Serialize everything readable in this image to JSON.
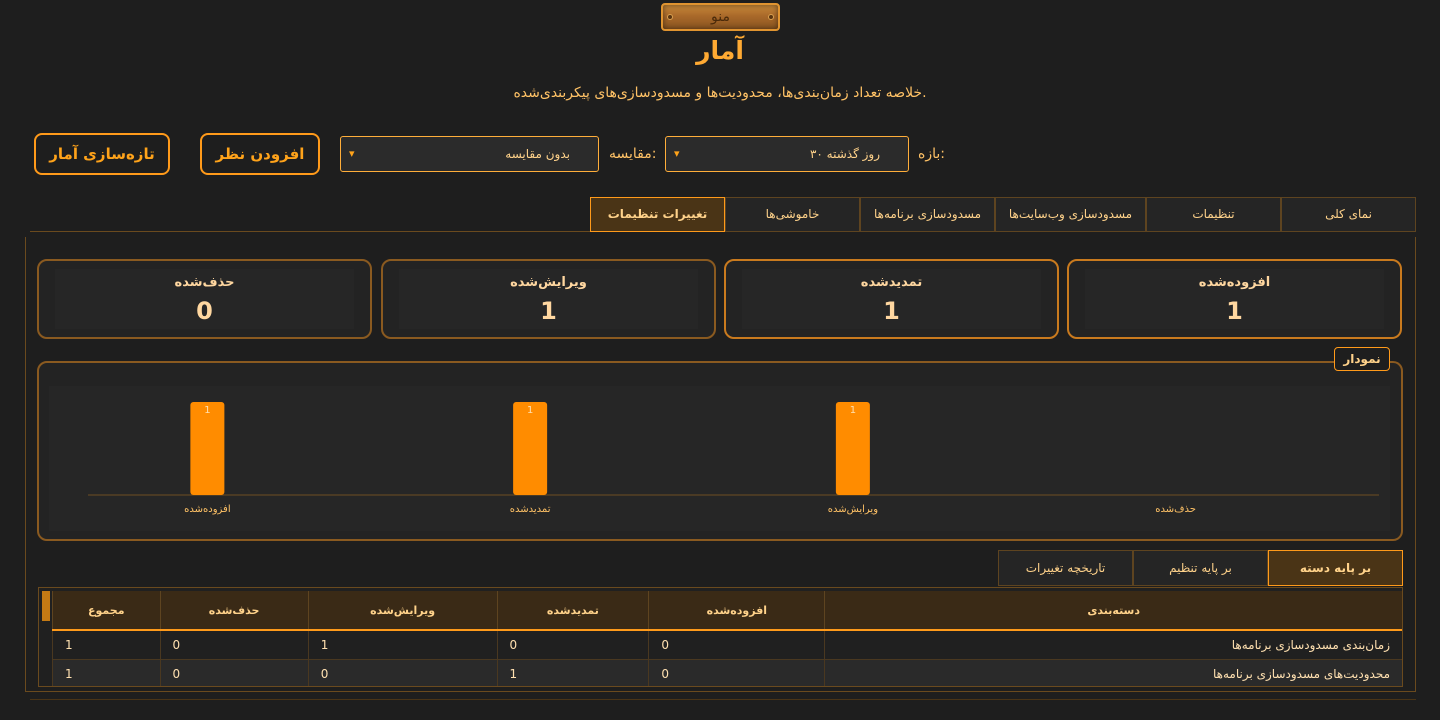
{
  "menu": {
    "label": "منو"
  },
  "page": {
    "title": "آمار",
    "subtitle": "خلاصه تعداد زمان‌بندی‌ها، محدودیت‌ها و مسدودسازی‌های پیکربندی‌شده."
  },
  "controls": {
    "range_label": "بازه:",
    "range_value": "روز گذشته ۳۰",
    "compare_label": "مقایسه:",
    "compare_value": "بدون مقایسه",
    "add_feedback": "افزودن نظر",
    "refresh": "تازه‌سازی آمار"
  },
  "tabs": [
    {
      "label": "نمای کلی"
    },
    {
      "label": "تنظیمات"
    },
    {
      "label": "مسدودسازی وب‌سایت‌ها"
    },
    {
      "label": "مسدودسازی برنامه‌ها"
    },
    {
      "label": "خاموشی‌ها"
    },
    {
      "label": "تغییرات تنظیمات"
    }
  ],
  "cards": [
    {
      "title": "افزوده‌شده",
      "value": "1"
    },
    {
      "title": "تمدیدشده",
      "value": "1"
    },
    {
      "title": "ویرایش‌شده",
      "value": "1"
    },
    {
      "title": "حذف‌شده",
      "value": "0"
    }
  ],
  "chart_section": {
    "legend": "نمودار"
  },
  "chart_data": {
    "type": "bar",
    "categories": [
      "افزوده‌شده",
      "تمدیدشده",
      "ویرایش‌شده",
      "حذف‌شده"
    ],
    "values": [
      1,
      1,
      1,
      0
    ],
    "ylim": [
      0,
      1
    ],
    "grid": false,
    "bar_color": "#ff8c00"
  },
  "subtabs": [
    {
      "label": "بر پایه دسته"
    },
    {
      "label": "بر پایه تنظیم"
    },
    {
      "label": "تاریخچه تغییرات"
    }
  ],
  "table": {
    "headers": [
      "دسته‌بندی",
      "افزوده‌شده",
      "تمدیدشده",
      "ویرایش‌شده",
      "حذف‌شده",
      "مجموع"
    ],
    "rows": [
      [
        "زمان‌بندی مسدودسازی برنامه‌ها",
        "0",
        "0",
        "1",
        "0",
        "1"
      ],
      [
        "محدودیت‌های مسدودسازی برنامه‌ها",
        "0",
        "1",
        "0",
        "0",
        "1"
      ]
    ]
  },
  "colors": {
    "accent": "#ff9a1a",
    "background": "#1e1e1e",
    "bar": "#ff8c00"
  }
}
